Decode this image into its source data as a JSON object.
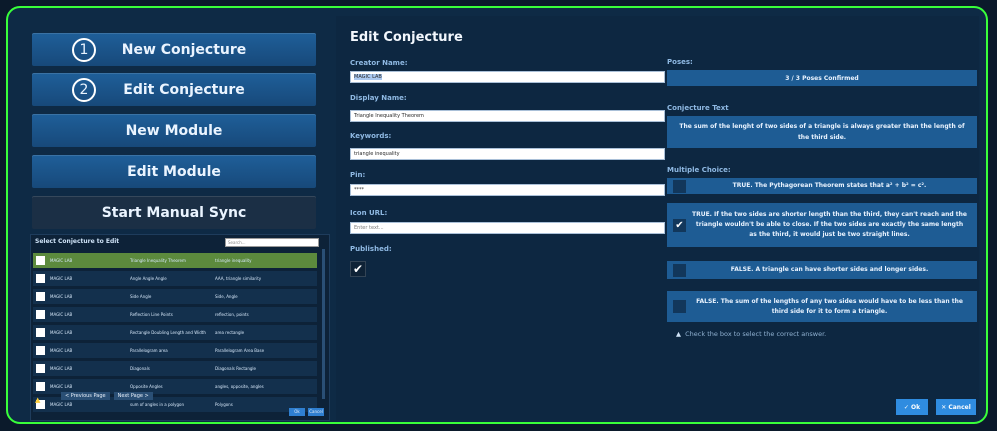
{
  "menu": {
    "new_conjecture": {
      "number": "1",
      "label": "New Conjecture"
    },
    "edit_conjecture": {
      "number": "2",
      "label": "Edit Conjecture"
    },
    "new_module": "New Module",
    "edit_module": "Edit Module",
    "start_sync": "Start Manual Sync"
  },
  "selector": {
    "title": "Select Conjecture to Edit",
    "search_placeholder": "Search...",
    "rows": [
      {
        "c1": "MAGIC LAB",
        "c2": "Triangle Inequality Theorem",
        "c3": "triangle inequality"
      },
      {
        "c1": "MAGIC LAB",
        "c2": "Angle Angle Angle",
        "c3": "AAA, triangle similarity"
      },
      {
        "c1": "MAGIC LAB",
        "c2": "Side Angle",
        "c3": "Side, Angle"
      },
      {
        "c1": "MAGIC LAB",
        "c2": "Reflection Line Points",
        "c3": "reflection, points"
      },
      {
        "c1": "MAGIC LAB",
        "c2": "Rectangle Doubling Length and Width",
        "c3": "area rectangle"
      },
      {
        "c1": "MAGIC LAB",
        "c2": "Parallelogram area",
        "c3": "Parallelogram Area Base"
      },
      {
        "c1": "MAGIC LAB",
        "c2": "Diagonals",
        "c3": "Diagonals Rectangle"
      },
      {
        "c1": "MAGIC LAB",
        "c2": "Opposite Angles",
        "c3": "angles, opposite, angles"
      },
      {
        "c1": "MAGIC LAB",
        "c2": "sum of angles in a polygon",
        "c3": "Polygons"
      }
    ],
    "prev_page": "< Previous Page",
    "next_page": "Next Page >",
    "ok": "Ok",
    "cancel": "Cancel"
  },
  "form": {
    "title": "Edit Conjecture",
    "creator_label": "Creator Name:",
    "creator_value": "MAGIC LAB",
    "display_label": "Display Name:",
    "display_value": "Triangle Inequality Theorem",
    "keywords_label": "Keywords:",
    "keywords_value": "triangle inequality",
    "pin_label": "Pin:",
    "pin_value": "****",
    "icon_label": "Icon URL:",
    "icon_placeholder": "Enter text...",
    "published_label": "Published:",
    "published_checked": true
  },
  "poses": {
    "label": "Poses:",
    "status": "3 / 3 Poses Confirmed"
  },
  "conjecture_text": {
    "label": "Conjecture Text",
    "text": "The sum of the lenght of two sides of a triangle is always greater than the length of the third side."
  },
  "multiple_choice": {
    "label": "Multiple Choice:",
    "options": [
      {
        "text": "TRUE. The Pythagorean Theorem states that a² + b² = c².",
        "checked": false
      },
      {
        "text": "TRUE. If the two sides are shorter length than the third, they can't reach and the triangle wouldn't be able to close. If the two sides are exactly the same length as the third, it would just be two straight lines.",
        "checked": true
      },
      {
        "text": "FALSE. A triangle can have shorter sides and longer sides.",
        "checked": false
      },
      {
        "text": "FALSE. The sum of the lengths of any two sides would have to be less than the third side for it to form a triangle.",
        "checked": false
      }
    ],
    "hint": "Check the box to select the correct answer."
  },
  "actions": {
    "ok": "✓ Ok",
    "cancel": "✕ Cancel"
  },
  "colors": {
    "frame_border": "#39ff3a",
    "button_blue": "#1e5c94",
    "accent": "#2f8ce0"
  }
}
